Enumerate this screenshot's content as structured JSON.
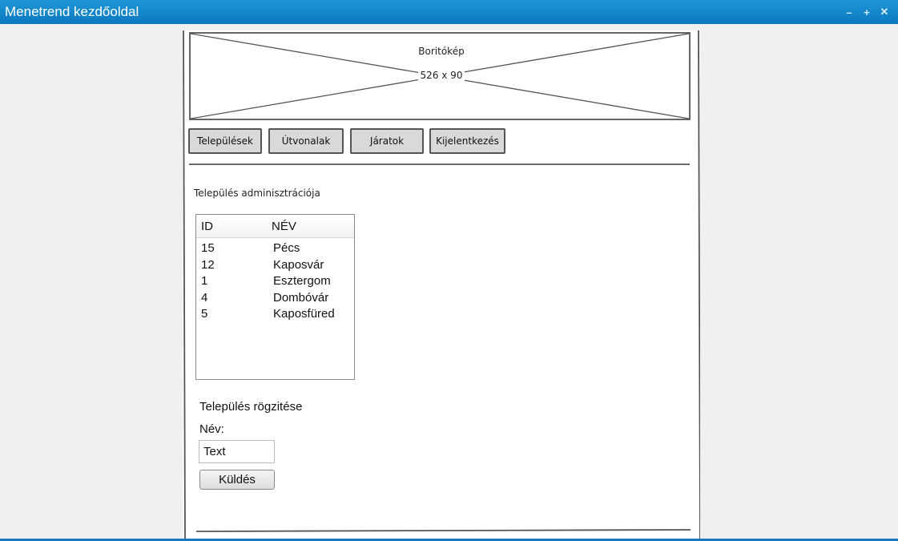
{
  "window": {
    "title": "Menetrend kezdőoldal",
    "controls": {
      "minimize_icon": "–",
      "maximize_icon": "+",
      "close_icon": "✕"
    }
  },
  "cover": {
    "title": "Boritókép",
    "size": "526 x 90"
  },
  "nav": {
    "items": [
      {
        "label": "Települések"
      },
      {
        "label": "Útvonalak"
      },
      {
        "label": "Járatok"
      },
      {
        "label": "Kijelentkezés"
      }
    ]
  },
  "admin": {
    "title": "Település adminisztrációja",
    "table": {
      "columns": [
        "ID",
        "NÉV"
      ],
      "rows": [
        {
          "id": "15",
          "name": "Pécs"
        },
        {
          "id": "12",
          "name": "Kaposvár"
        },
        {
          "id": "1",
          "name": "Esztergom"
        },
        {
          "id": "4",
          "name": "Dombóvár"
        },
        {
          "id": "5",
          "name": "Kaposfüred"
        }
      ]
    }
  },
  "form": {
    "title": "Település rögzitése",
    "name_label": "Név:",
    "name_value": "Text",
    "submit_label": "Küldés"
  },
  "colors": {
    "titlebar": "#1789cf",
    "background": "#f0f0f0",
    "sketch_line": "#555555"
  }
}
